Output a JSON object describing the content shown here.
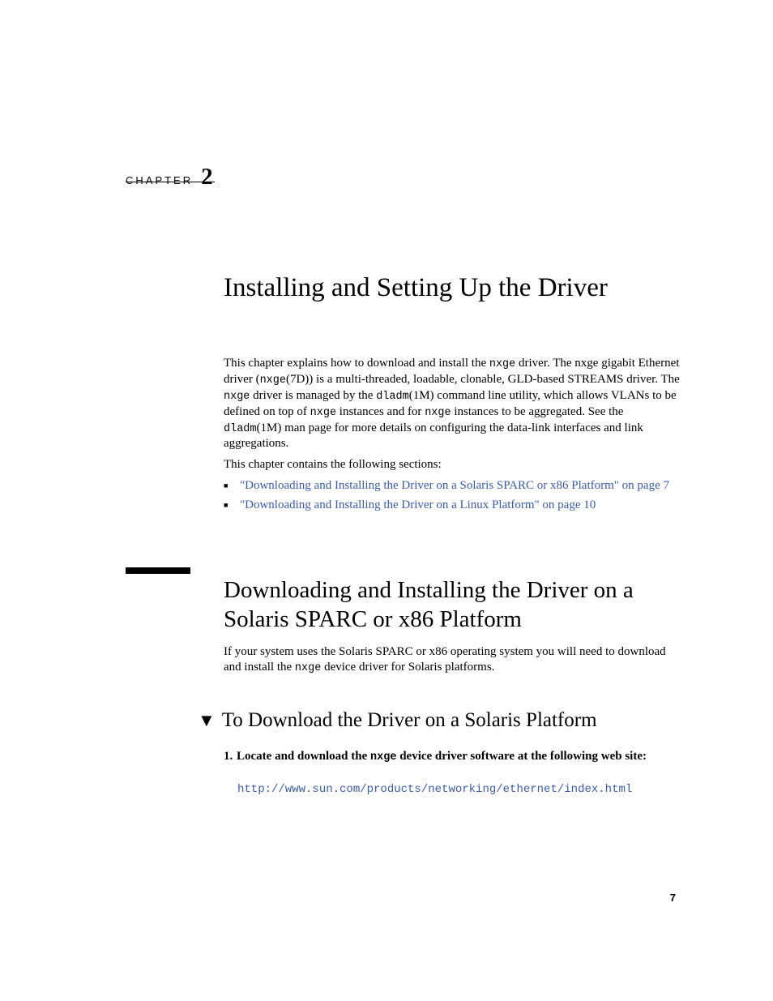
{
  "chapter": {
    "label": "CHAPTER",
    "number": "2"
  },
  "title": "Installing and Setting Up the Driver",
  "intro": {
    "t1": "This chapter explains how to download and install the ",
    "m1": "nxge",
    "t2": " driver. The nxge gigabit Ethernet driver (",
    "m2": "nxge",
    "t3": "(7D)) is a multi-threaded, loadable, clonable, GLD-based STREAMS driver. The ",
    "m3": "nxge",
    "t4": " driver is managed by the ",
    "m4": "dladm",
    "t5": "(1M) command line utility, which allows VLANs to be defined on top of ",
    "m5": "nxge",
    "t6": " instances and for ",
    "m6": "nxge",
    "t7": " instances to be aggregated. See the ",
    "m7": "dladm",
    "t8": "(1M) man page for more details on configuring the data-link interfaces and link aggregations."
  },
  "sections_intro": "This chapter contains the following sections:",
  "bullets": {
    "b1": "\"Downloading and Installing the Driver on a Solaris SPARC or x86 Platform\" on page 7",
    "b2": "\"Downloading and Installing the Driver on a Linux Platform\" on page 10"
  },
  "section": {
    "title": "Downloading and Installing the Driver on a Solaris SPARC or x86 Platform",
    "para_t1": "If your system uses the Solaris SPARC or x86 operating system you will need to download and install the ",
    "para_m1": "nxge",
    "para_t2": " device driver for Solaris platforms."
  },
  "subsection": {
    "title": "To Download the Driver on a Solaris Platform"
  },
  "step1": {
    "num": "1.",
    "t1": "Locate and download the ",
    "m1": "nxge",
    "t2": " device driver software at the following web site:",
    "url": "http://www.sun.com/products/networking/ethernet/index.html"
  },
  "page_number": "7"
}
